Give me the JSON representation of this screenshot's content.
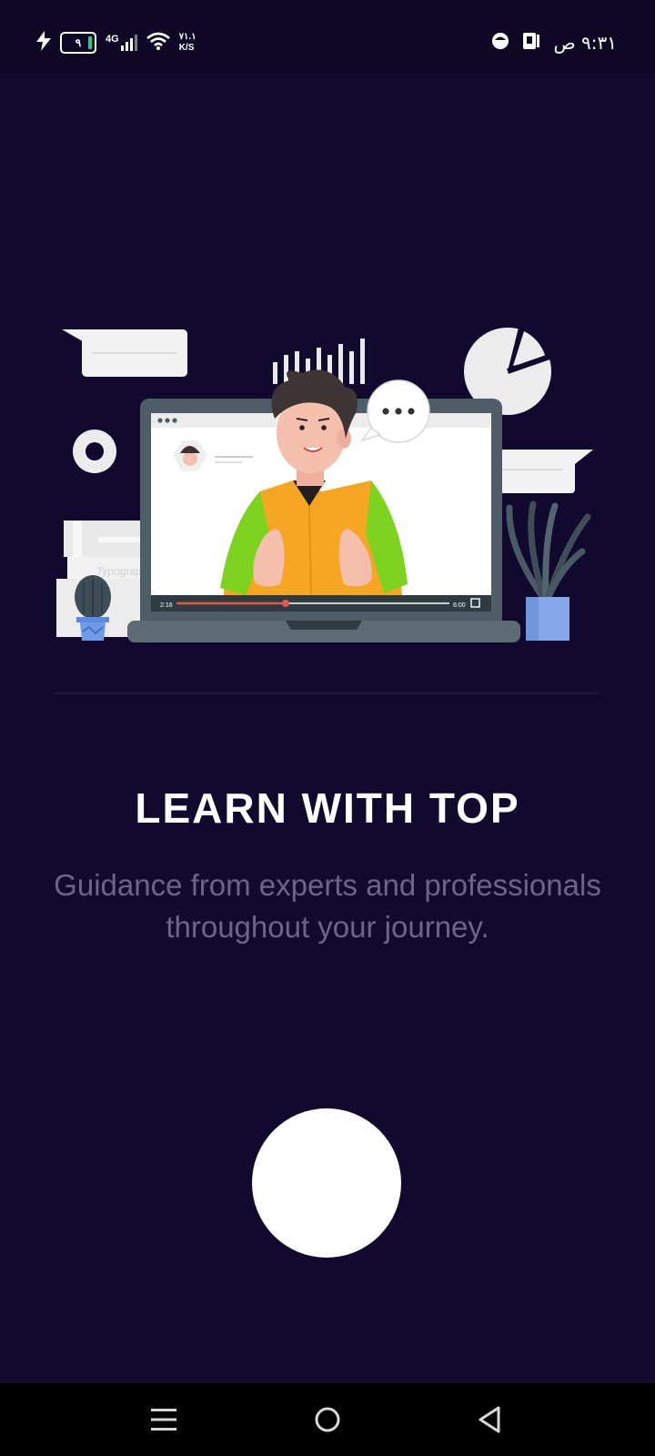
{
  "status_bar": {
    "battery_level": "٩",
    "network_type": "4G",
    "speed_value": "٧١.١",
    "speed_unit": "K/S",
    "time": "٩:٣١ ص",
    "icons": [
      "charging-icon",
      "battery-icon",
      "signal-icon",
      "wifi-icon",
      "app-notification-icon",
      "sim-icon"
    ]
  },
  "colors": {
    "background": "#120a2e",
    "headline": "#ffffff",
    "subtitle": "#6f6388",
    "button": "#ffffff",
    "shirt": "#f5a623",
    "sleeves": "#7ed321",
    "laptop": "#4f5d66",
    "progress": "#e8564b"
  },
  "onboarding": {
    "title": "LEARN WITH TOP",
    "subtitle": "Guidance from experts and professionals throughout your journey."
  },
  "video_player": {
    "current_time": "2:16",
    "total_time": "6:00",
    "progress": 0.4
  },
  "book_label": "Typography",
  "nav_bar": {
    "buttons": [
      "menu-icon",
      "home-icon",
      "back-icon"
    ]
  }
}
